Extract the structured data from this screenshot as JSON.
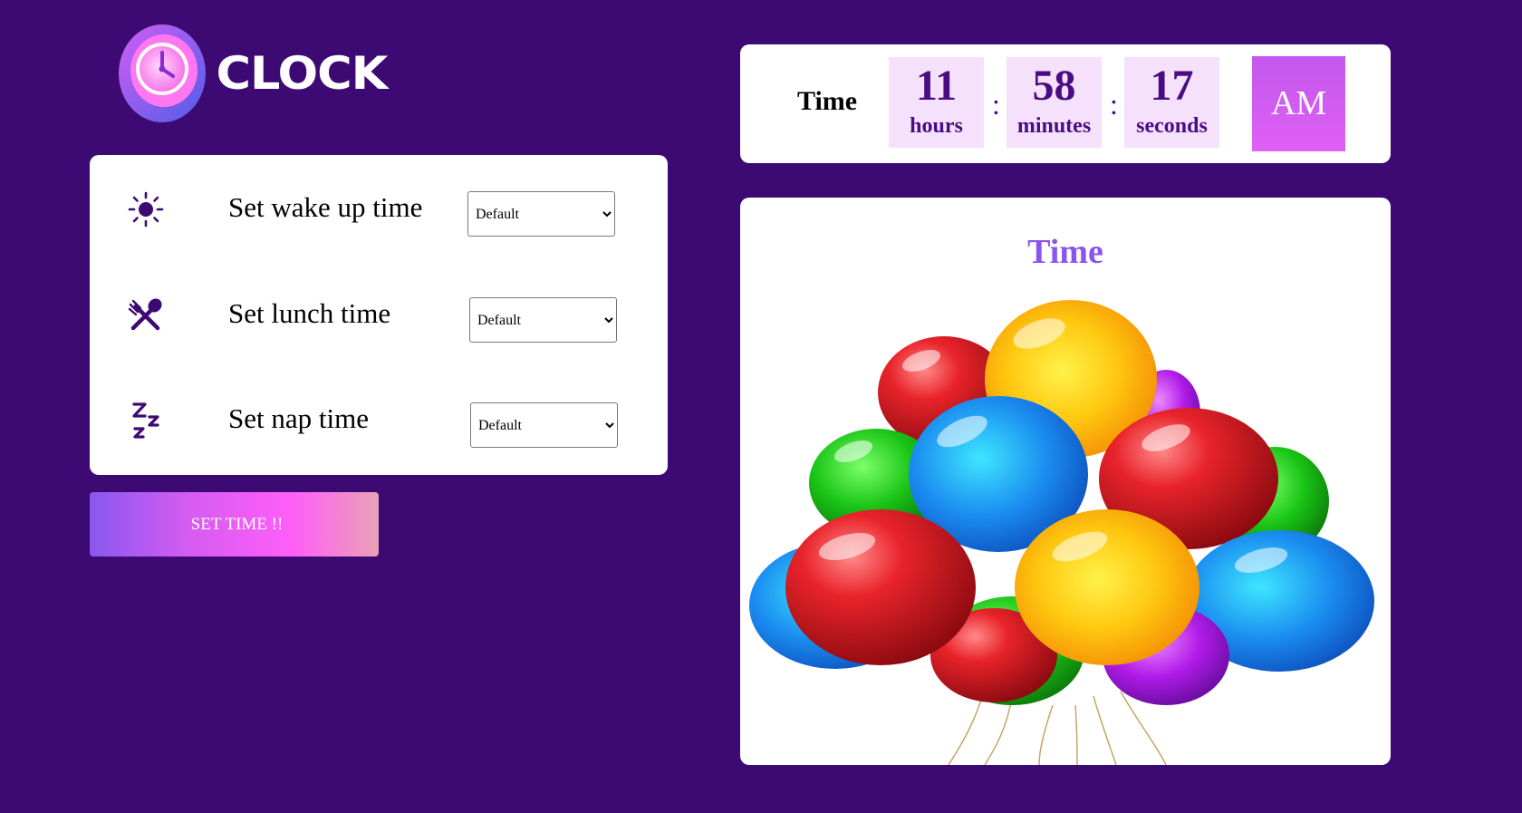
{
  "app": {
    "logo_text": "CLOCK",
    "logo_icon": "clock-icon"
  },
  "colors": {
    "page_bg": "#3d0a73",
    "accent_purple": "#8a55ec",
    "digit_bg": "#f5e1fb",
    "digit_text": "#4a0c85"
  },
  "settings": {
    "rows": [
      {
        "icon": "sun-icon",
        "label": "Set wake up time",
        "select_value": "Default"
      },
      {
        "icon": "fork-spoon-icon",
        "label": "Set lunch time",
        "select_value": "Default"
      },
      {
        "icon": "sleep-zzz-icon",
        "label": "Set nap time",
        "select_value": "Default"
      }
    ],
    "button_label": "SET TIME !!"
  },
  "clock": {
    "label": "Time",
    "hours": "11",
    "hours_label": "hours",
    "minutes": "58",
    "minutes_label": "minutes",
    "seconds": "17",
    "seconds_label": "seconds",
    "separator": ":",
    "period": "AM"
  },
  "display": {
    "heading": "Time",
    "image": "balloons-image"
  }
}
